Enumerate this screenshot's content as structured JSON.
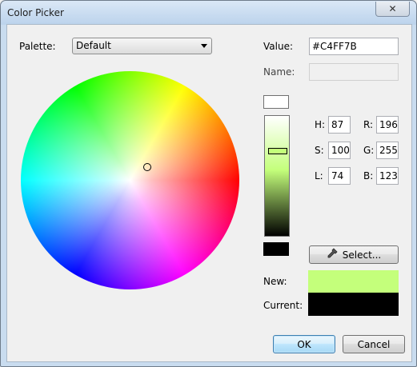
{
  "window": {
    "title": "Color Picker",
    "close_glyph": "✕"
  },
  "palette": {
    "label": "Palette:",
    "selected": "Default"
  },
  "value": {
    "label": "Value:",
    "text": "#C4FF7B"
  },
  "name": {
    "label": "Name:",
    "text": ""
  },
  "hsl": {
    "h_label": "H:",
    "h": "87",
    "s_label": "S:",
    "s": "100",
    "l_label": "L:",
    "l": "74"
  },
  "rgb": {
    "r_label": "R:",
    "r": "196",
    "g_label": "G:",
    "g": "255",
    "b_label": "B:",
    "b": "123"
  },
  "select_button": {
    "label": "Select...",
    "icon": "eyedropper-icon"
  },
  "preview": {
    "new_label": "New:",
    "new_color": "#c4ff7b",
    "current_label": "Current:",
    "current_color": "#000000"
  },
  "brightness": {
    "top_swatch_color": "#ffffff",
    "bottom_swatch_color": "#000000",
    "level": 0.74
  },
  "buttons": {
    "ok": "OK",
    "cancel": "Cancel"
  }
}
